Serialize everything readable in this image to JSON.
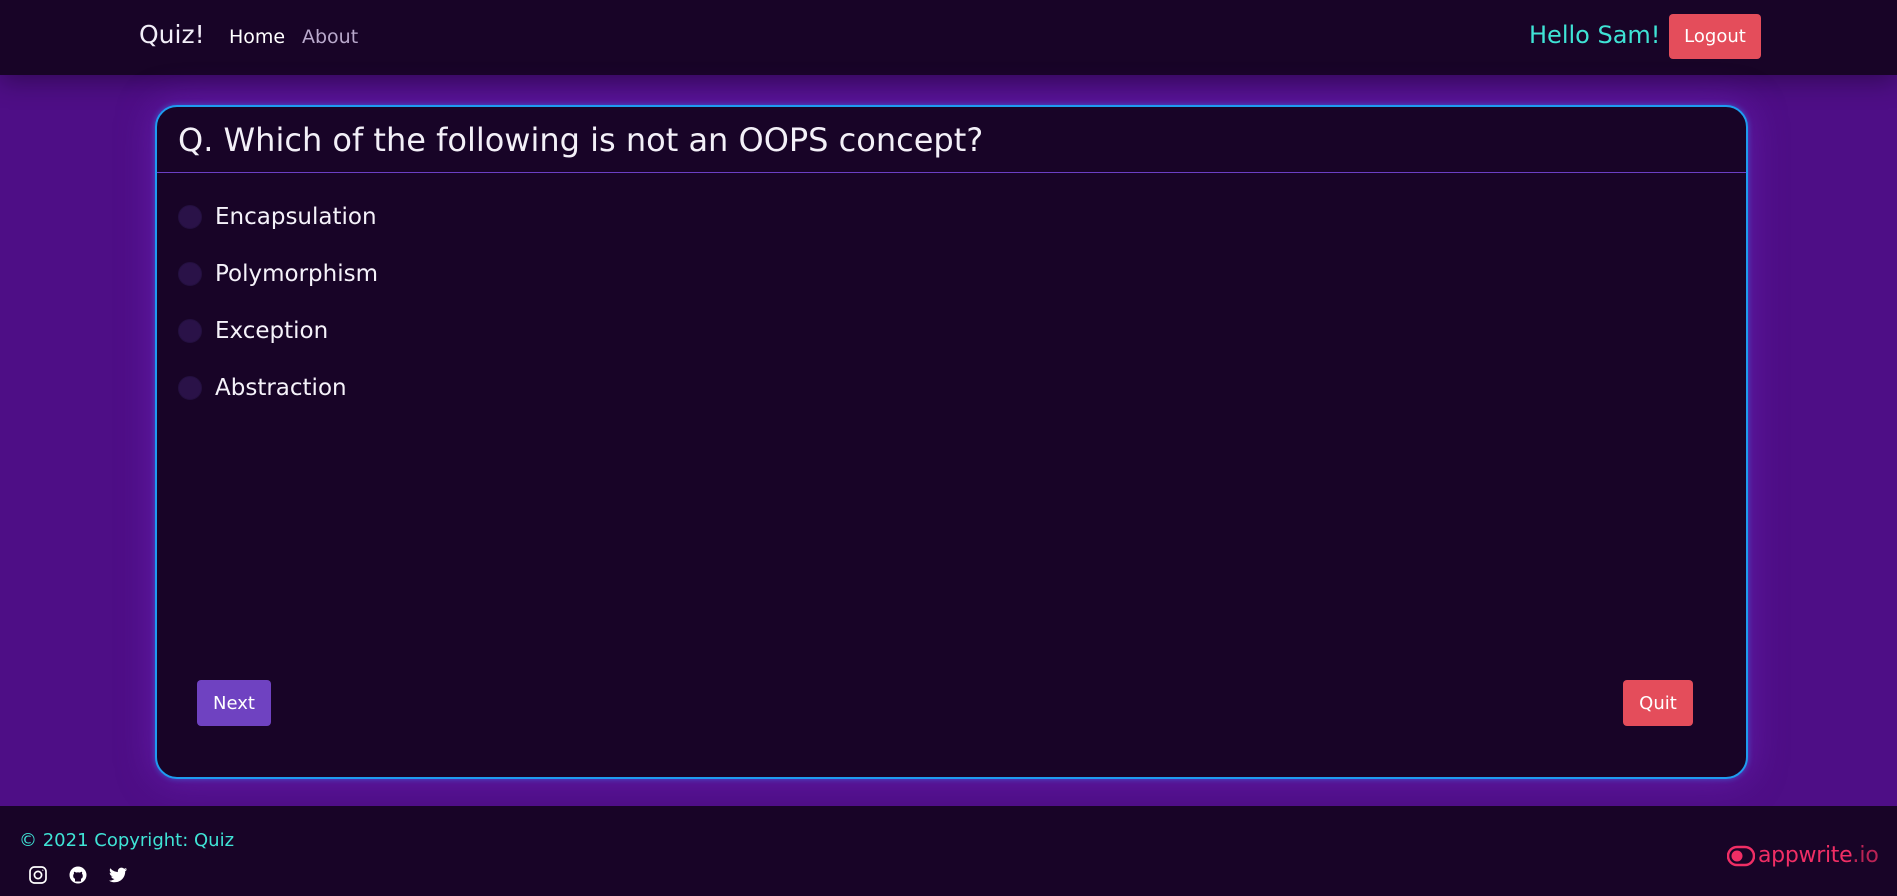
{
  "navbar": {
    "brand": "Quiz!",
    "links": [
      {
        "label": "Home",
        "active": true
      },
      {
        "label": "About",
        "active": false
      }
    ],
    "greeting": "Hello Sam!",
    "logout_label": "Logout"
  },
  "quiz": {
    "question": "Q. Which of the following is not an OOPS concept?",
    "options": [
      {
        "label": "Encapsulation",
        "selected": false
      },
      {
        "label": "Polymorphism",
        "selected": false
      },
      {
        "label": "Exception",
        "selected": false
      },
      {
        "label": "Abstraction",
        "selected": false
      }
    ],
    "next_label": "Next",
    "quit_label": "Quit"
  },
  "footer": {
    "copyright": "© 2021 Copyright: Quiz",
    "socials": [
      "instagram-icon",
      "github-icon",
      "twitter-icon"
    ],
    "appwrite_name": "appwrite",
    "appwrite_tld": ".io"
  },
  "colors": {
    "background": "#4e0e86",
    "panel": "#180427",
    "accent_teal": "#3fe3d5",
    "danger": "#e44d5b",
    "primary": "#6f42c1",
    "card_border": "#1e9cf0",
    "appwrite_pink": "#f02e65"
  }
}
